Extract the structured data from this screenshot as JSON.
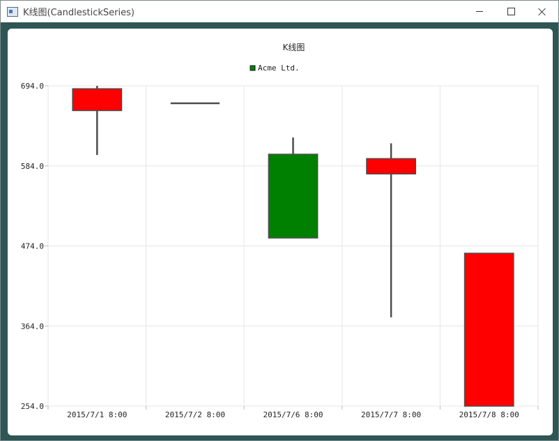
{
  "window": {
    "title": "K线图(CandlestickSeries)",
    "icons": {
      "app": "app-window-icon",
      "minimize": "minimize-icon",
      "maximize": "maximize-icon",
      "close": "close-icon"
    }
  },
  "chart_data": {
    "type": "candlestick",
    "title": "K线图",
    "legend": {
      "position": "top-center",
      "entries": [
        {
          "name": "Acme Ltd.",
          "color": "#008000"
        }
      ]
    },
    "categories": [
      "2015/7/1 8:00",
      "2015/7/2 8:00",
      "2015/7/6 8:00",
      "2015/7/7 8:00",
      "2015/7/8 8:00"
    ],
    "series": [
      {
        "name": "Acme Ltd.",
        "open": [
          660,
          670,
          600,
          573,
          254
        ],
        "close": [
          690,
          670,
          485,
          594,
          464
        ],
        "high": [
          694,
          670,
          623,
          615,
          464
        ],
        "low": [
          599,
          670,
          600,
          376,
          254
        ]
      }
    ],
    "increasing_color": "#ff0000",
    "decreasing_color": "#008000",
    "outline_color": "#4d4d4d",
    "ylim": [
      254,
      694
    ],
    "yticks": [
      "694.0",
      "584.0",
      "474.0",
      "364.0",
      "254.0"
    ],
    "ytick_values": [
      694,
      584,
      474,
      364,
      254
    ],
    "grid": true
  }
}
